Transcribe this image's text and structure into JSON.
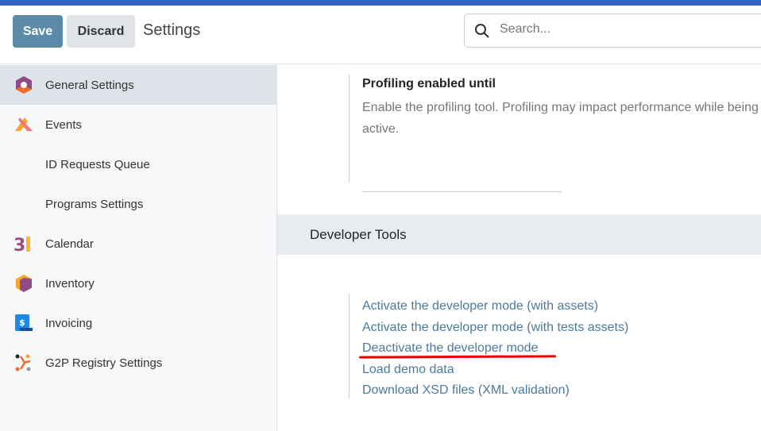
{
  "header": {
    "save_label": "Save",
    "discard_label": "Discard",
    "title": "Settings",
    "search_placeholder": "Search..."
  },
  "sidebar": {
    "items": [
      {
        "label": "General Settings",
        "icon": "general-settings-icon"
      },
      {
        "label": "Events",
        "icon": "events-icon"
      },
      {
        "label": "ID Requests Queue"
      },
      {
        "label": "Programs Settings"
      },
      {
        "label": "Calendar",
        "icon": "calendar-icon"
      },
      {
        "label": "Inventory",
        "icon": "inventory-icon"
      },
      {
        "label": "Invoicing",
        "icon": "invoicing-icon"
      },
      {
        "label": "G2P Registry Settings",
        "icon": "g2p-registry-icon"
      }
    ]
  },
  "main": {
    "profiling": {
      "title": "Profiling enabled until",
      "description": "Enable the profiling tool. Profiling may impact performance while being active."
    },
    "section_title": "Developer Tools",
    "links": [
      "Activate the developer mode (with assets)",
      "Activate the developer mode (with tests assets)",
      "Deactivate the developer mode",
      "Load demo data",
      "Download XSD files (XML validation)"
    ]
  },
  "colors": {
    "topbar": "#3163c4",
    "save": "#5b8ba8",
    "link": "#4a7a9c",
    "annotation": "#ee0000"
  }
}
